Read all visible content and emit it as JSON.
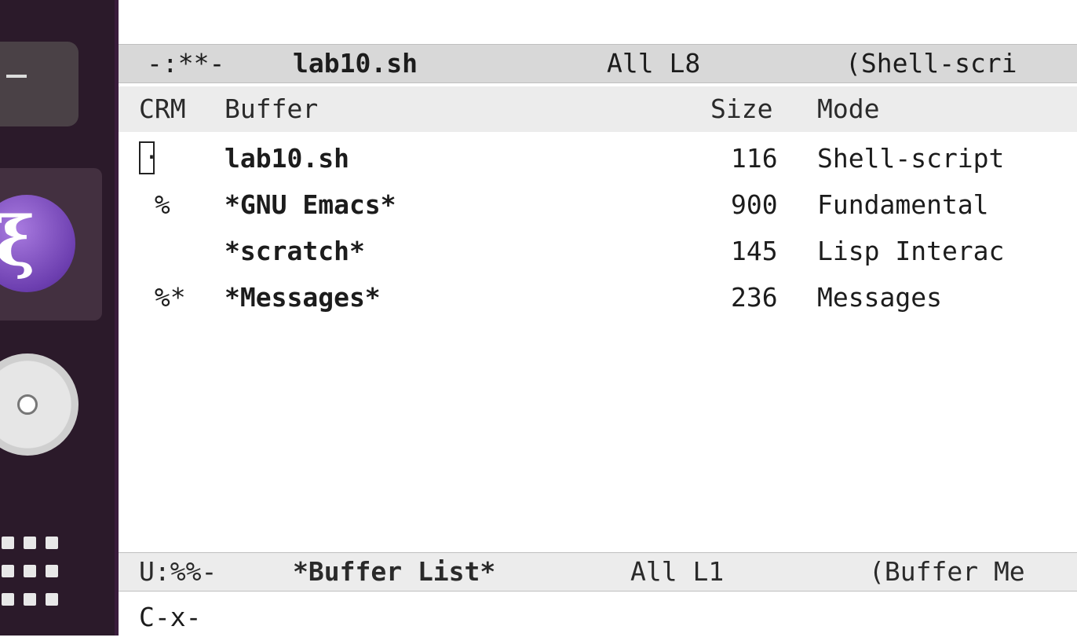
{
  "dock": {
    "items": [
      {
        "name": "Terminal",
        "icon": "terminal-icon"
      },
      {
        "name": "Emacs",
        "icon": "emacs-icon",
        "active": true
      },
      {
        "name": "Disc",
        "icon": "disc-icon"
      },
      {
        "name": "Show Applications",
        "icon": "apps-grid-icon"
      }
    ]
  },
  "top_modeline": {
    "status": "-:**-",
    "buffer": "lab10.sh",
    "position": "All L8",
    "mode": "(Shell-scri"
  },
  "buffer_list": {
    "columns": {
      "crm": "CRM",
      "buffer": "Buffer",
      "size": "Size",
      "mode": "Mode"
    },
    "rows": [
      {
        "crm": ".",
        "buffer": "lab10.sh",
        "size": "116",
        "mode": "Shell-script"
      },
      {
        "crm": " %",
        "buffer": "*GNU Emacs*",
        "size": "900",
        "mode": "Fundamental"
      },
      {
        "crm": "",
        "buffer": "*scratch*",
        "size": "145",
        "mode": "Lisp Interac"
      },
      {
        "crm": " %*",
        "buffer": "*Messages*",
        "size": "236",
        "mode": "Messages"
      }
    ]
  },
  "bottom_modeline": {
    "status": "U:%%-",
    "buffer": "*Buffer List*",
    "position": "All L1",
    "mode": "(Buffer Me"
  },
  "echo_area": {
    "text": "C-x-"
  },
  "colors": {
    "dock_bg": "#2b1a2a",
    "modeline_bg": "#d8d8d8",
    "emacs_purple": "#7b4cc4"
  }
}
